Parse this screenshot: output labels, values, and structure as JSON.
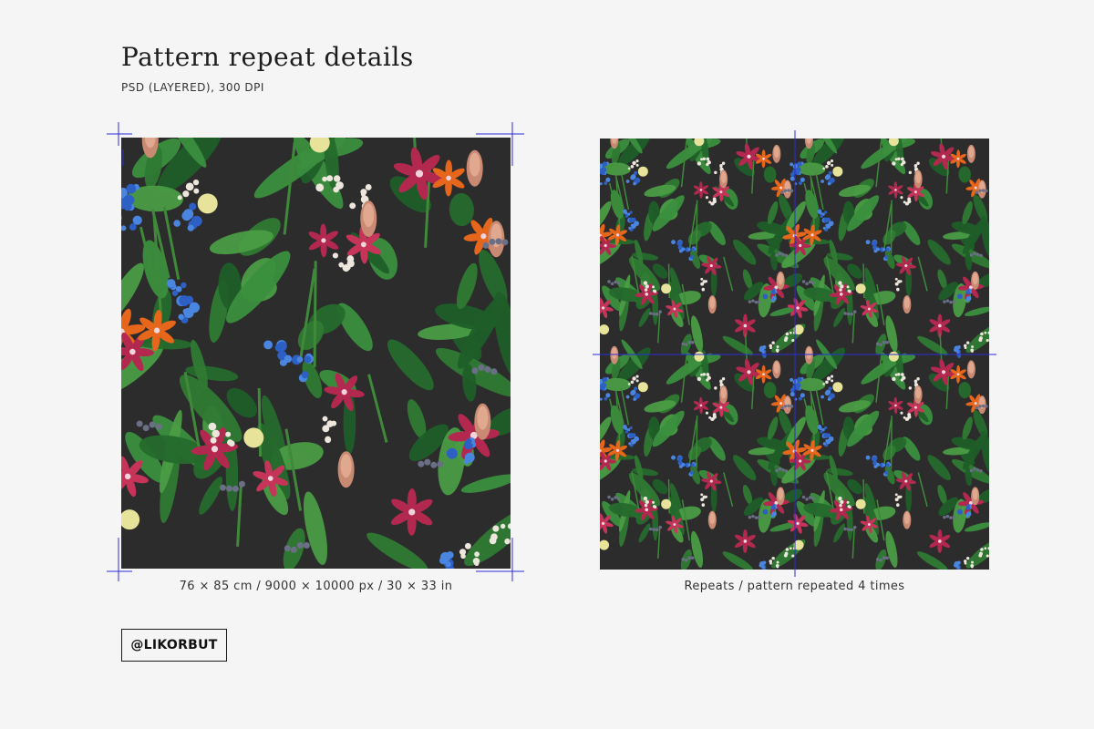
{
  "header": {
    "title": "Pattern repeat details",
    "subtitle": "PSD (LAYERED), 300 DPI"
  },
  "panels": {
    "single": {
      "caption": "76 × 85 cm / 9000 × 10000 px / 30 × 33 in"
    },
    "repeat": {
      "caption": "Repeats / pattern repeated 4 times",
      "repeat_count": 4
    }
  },
  "brand": {
    "logo_text": "@LIKORBUT"
  },
  "colors": {
    "page_background": "#f5f5f5",
    "pattern_background": "#2c2c2c",
    "guide_lines": "#2b2bd6",
    "leaf": "#2f7a34",
    "flower_pink": "#c6345a",
    "flower_orange": "#e6661c",
    "flower_blue": "#2d5fc4",
    "flower_white": "#ece6dc"
  }
}
